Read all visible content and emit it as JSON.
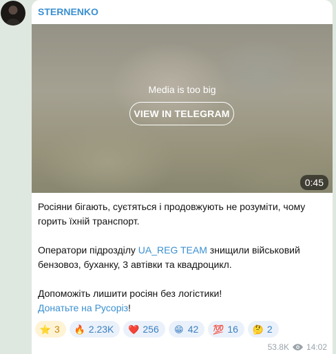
{
  "message": {
    "channel_name": "STERNENKO",
    "media": {
      "notice": "Media is too big",
      "button_label": "VIEW IN TELEGRAM",
      "duration": "0:45"
    },
    "text": {
      "p1": "Росіяни бігають, суєтяться і продовжують не розуміти, чому горить їхній транспорт.",
      "p2_before": "Оператори підрозділу ",
      "p2_link": "UA_REG TEAM",
      "p2_after": " знищили військовий бензовоз, буханку, 3 автівки та квадроцикл.",
      "p3": "Допоможіть лишити росіян без логістики!",
      "p4_link": "Донатьте на Русоріз",
      "p4_after": "!"
    },
    "reactions": [
      {
        "emoji": "⭐",
        "icon": "star-icon",
        "count": "3"
      },
      {
        "emoji": "🔥",
        "icon": "fire-icon",
        "count": "2.23K"
      },
      {
        "emoji": "❤️",
        "icon": "heart-icon",
        "count": "256"
      },
      {
        "emoji": "😁",
        "icon": "grinning-face-icon",
        "count": "42"
      },
      {
        "emoji": "💯",
        "icon": "hundred-points-icon",
        "count": "16"
      },
      {
        "emoji": "🤔",
        "icon": "thinking-face-icon",
        "count": "2"
      }
    ],
    "views": "53.8K",
    "time": "14:02"
  }
}
